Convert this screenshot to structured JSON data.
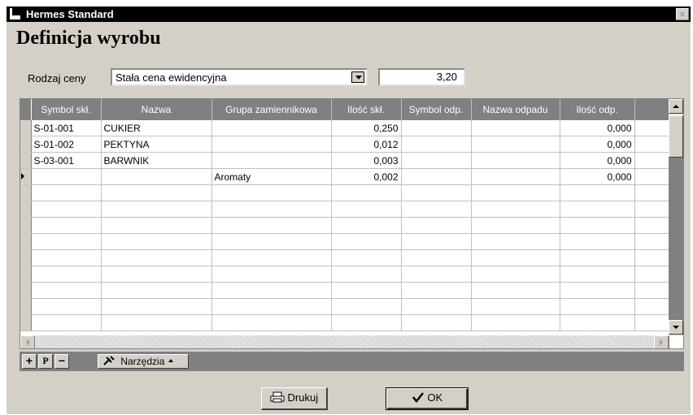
{
  "window": {
    "title": "Hermes Standard",
    "close_glyph": "×"
  },
  "header": {
    "title": "Definicja wyrobu"
  },
  "form": {
    "price_type_label": "Rodzaj ceny",
    "price_type_value": "Stała cena ewidencyjna",
    "price_value": "3,20"
  },
  "grid": {
    "columns": [
      "Symbol skł.",
      "Nazwa",
      "Grupa zamiennikowa",
      "Ilość skł.",
      "Symbol odp.",
      "Nazwa odpadu",
      "Ilość odp."
    ],
    "rows": [
      [
        "S-01-001",
        "CUKIER",
        "",
        "0,250",
        "",
        "",
        "0,000"
      ],
      [
        "S-01-002",
        "PEKTYNA",
        "",
        "0,012",
        "",
        "",
        "0,000"
      ],
      [
        "S-03-001",
        "BARWNIK",
        "",
        "0,003",
        "",
        "",
        "0,000"
      ],
      [
        "",
        "",
        "Aromaty",
        "0,002",
        "",
        "",
        "0,000"
      ]
    ],
    "current_row": 3
  },
  "toolbar": {
    "add_glyph": "+",
    "p_label": "P",
    "remove_glyph": "−",
    "tools_label": "Narzędzia"
  },
  "footer": {
    "print_label": "Drukuj",
    "ok_label": "OK"
  },
  "icons": {
    "tools": "tools-icon",
    "printer": "printer-icon",
    "check": "checkmark-icon"
  }
}
